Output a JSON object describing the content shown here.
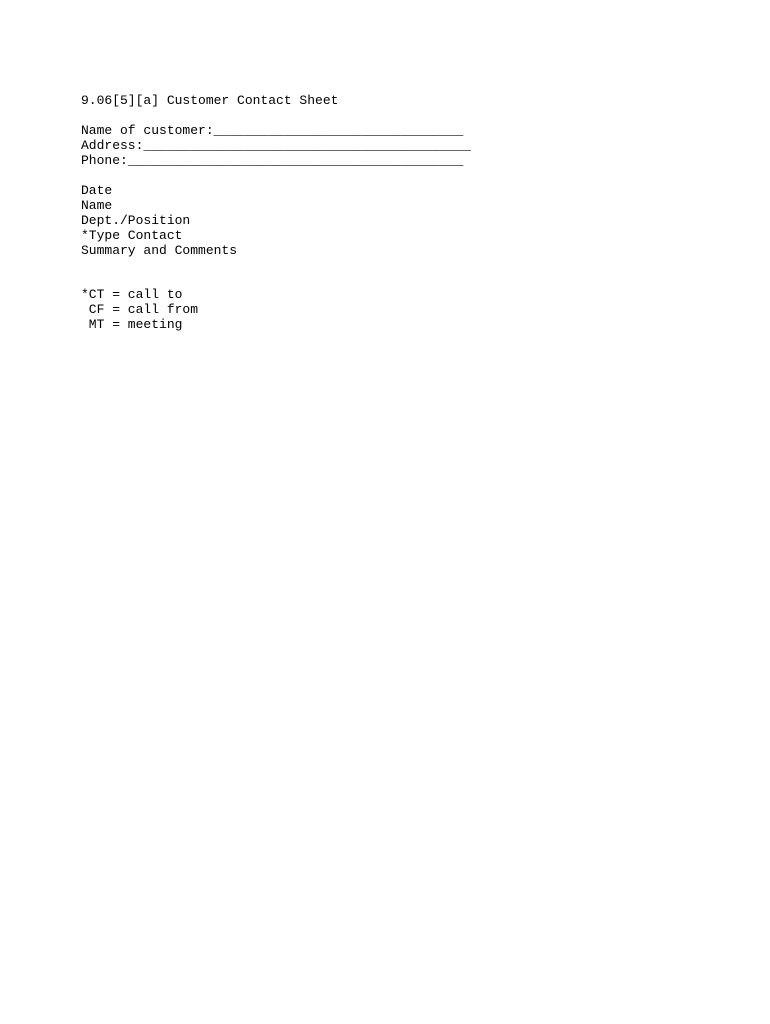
{
  "title": "9.06[5][a] Customer Contact Sheet",
  "fields": {
    "name_label": "Name of customer:",
    "name_blank": "________________________________",
    "address_label": "Address:",
    "address_blank": "__________________________________________",
    "phone_label": "Phone:",
    "phone_blank": "___________________________________________"
  },
  "columns": [
    "Date",
    "Name",
    "Dept./Position",
    "*Type Contact",
    "Summary and Comments"
  ],
  "legend": [
    "*CT = call to",
    " CF = call from",
    " MT = meeting"
  ]
}
